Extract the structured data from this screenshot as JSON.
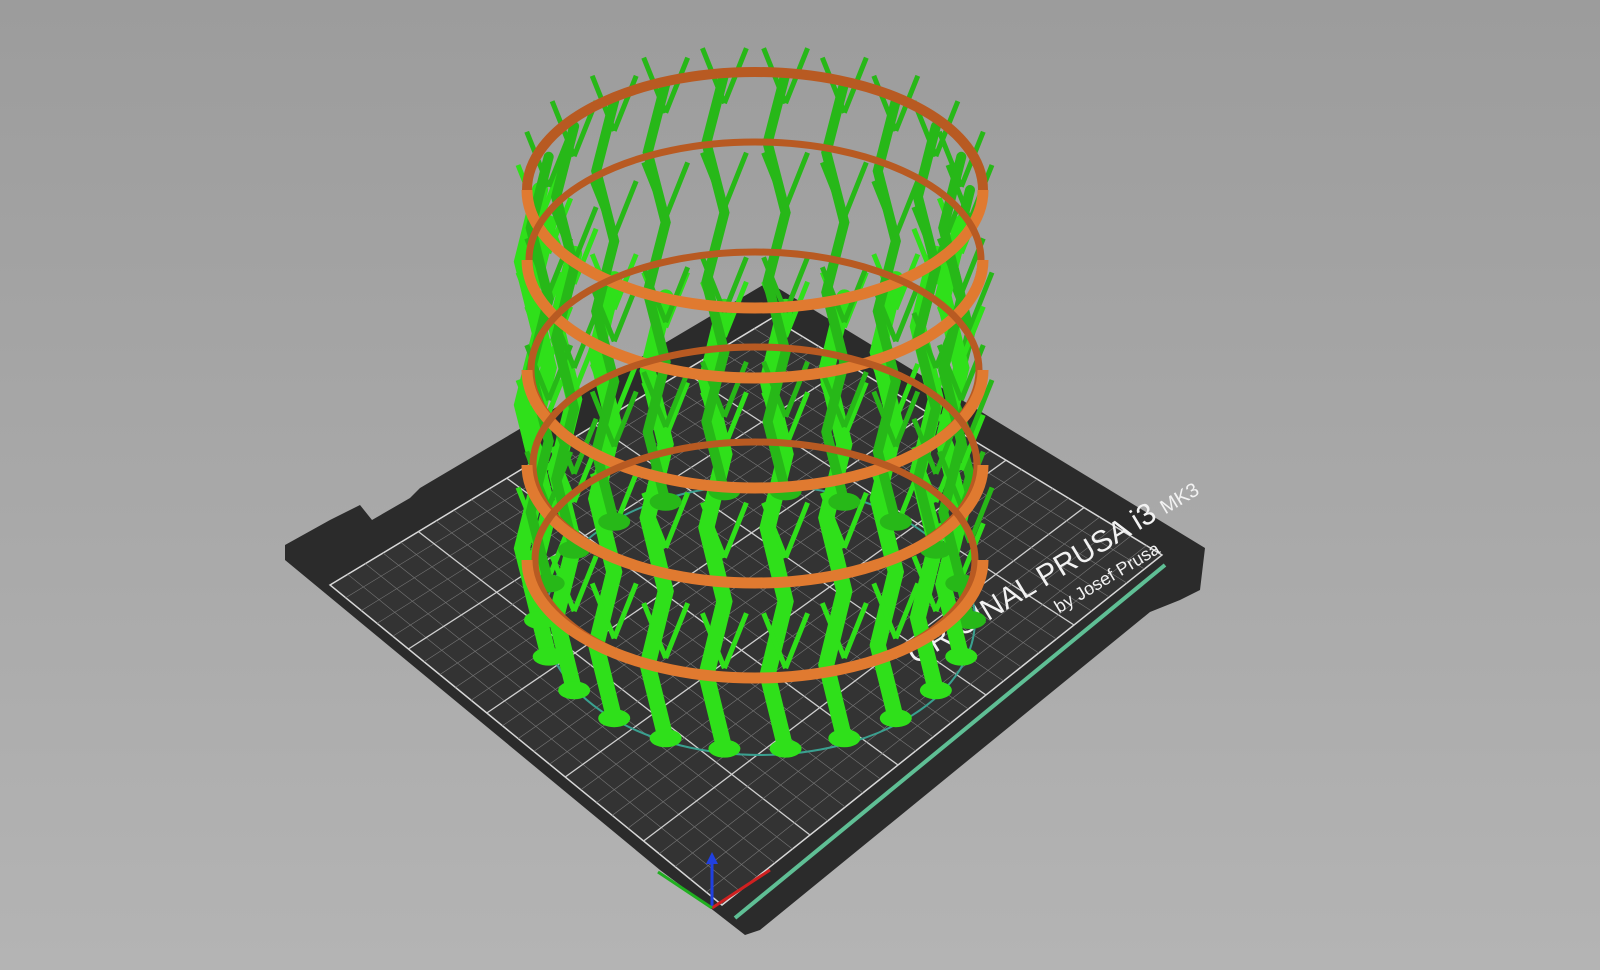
{
  "viewport": {
    "bed_model": "ORIGINAL PRUSA i3",
    "bed_variant": "MK3",
    "bed_byline": "by Josef Prusa"
  },
  "colors": {
    "background_top": "#9c9c9c",
    "background_bottom": "#b4b4b4",
    "bed": "#2b2b2b",
    "grid": "#8a8a8a",
    "support": "#2fe01a",
    "perimeter": "#d9702c",
    "axis_x": "#d02020",
    "axis_y": "#20b020",
    "axis_z": "#2040e0"
  }
}
